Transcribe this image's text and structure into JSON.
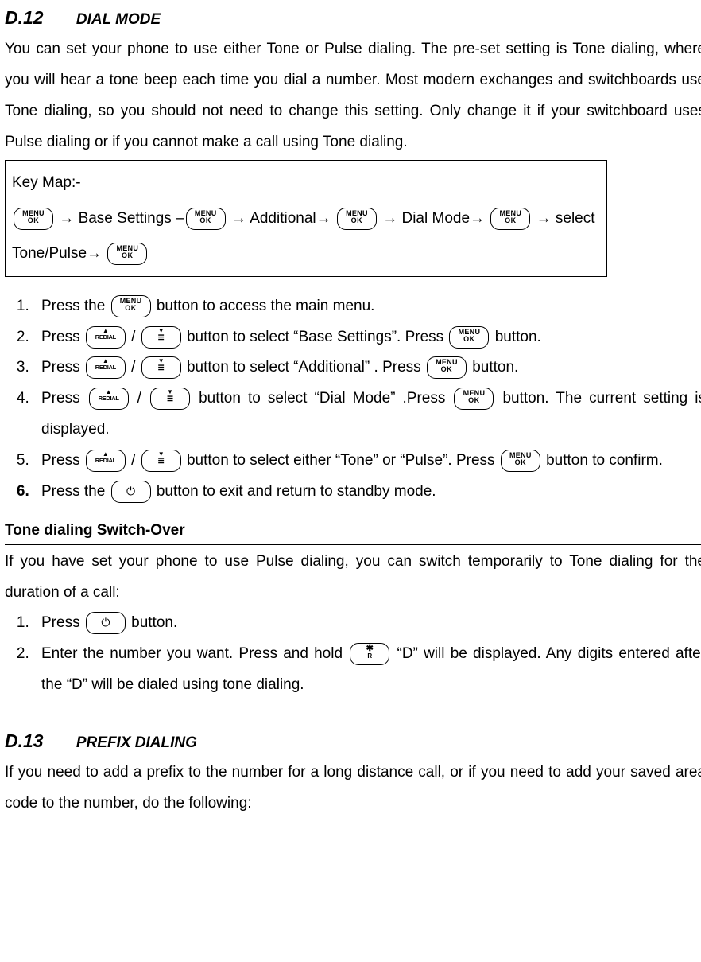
{
  "s1": {
    "num": "D.12",
    "title": "DIAL MODE",
    "intro": "You can set your phone to use either Tone or Pulse dialing. The pre-set setting is Tone dialing, where you will hear a tone beep each time you dial a number. Most modern exchanges and switchboards use Tone dialing, so you should not need to change this setting. Only change it if your switchboard uses Pulse dialing or if you cannot make a call using Tone dialing.",
    "keymap_label": "Key Map:-",
    "km": {
      "arrow": "→",
      "base_settings": "Base Settings",
      "dash": "–",
      "additional": "Additional",
      "dial_mode": "Dial Mode",
      "select_text": "select",
      "tone_pulse": "Tone/Pulse"
    },
    "steps": [
      {
        "a": "Press the ",
        "b": " button to access the main menu."
      },
      {
        "a": "Press ",
        "b": " button to select “Base Settings”. Press ",
        "c": " button."
      },
      {
        "a": "Press ",
        "b": " button to select “Additional” . Press ",
        "c": " button."
      },
      {
        "a": "Press ",
        "b": " button to select “Dial Mode” .Press ",
        "c": " button. The current setting is displayed."
      },
      {
        "a": "Press ",
        "b": " button to select either “Tone” or “Pulse”. Press ",
        "c": " button to confirm."
      },
      {
        "a": "Press the ",
        "b": " button to exit and return to standby mode."
      }
    ],
    "tone_heading": "Tone dialing Switch-Over",
    "tone_intro": "If you have set your phone to use Pulse dialing, you can switch temporarily to Tone dialing for the duration of a call:",
    "tone_steps": [
      {
        "a": "Press ",
        "b": " button."
      },
      {
        "a": "Enter the number you want. Press and hold ",
        "b": " “D” will be displayed. Any digits entered after the “D” will be dialed using tone dialing."
      }
    ]
  },
  "s2": {
    "num": "D.13",
    "title": "PREFIX DIALING",
    "intro": "If you need to add a prefix to the number for a long distance call, or if you need to add your saved area code to the number, do the following:"
  }
}
